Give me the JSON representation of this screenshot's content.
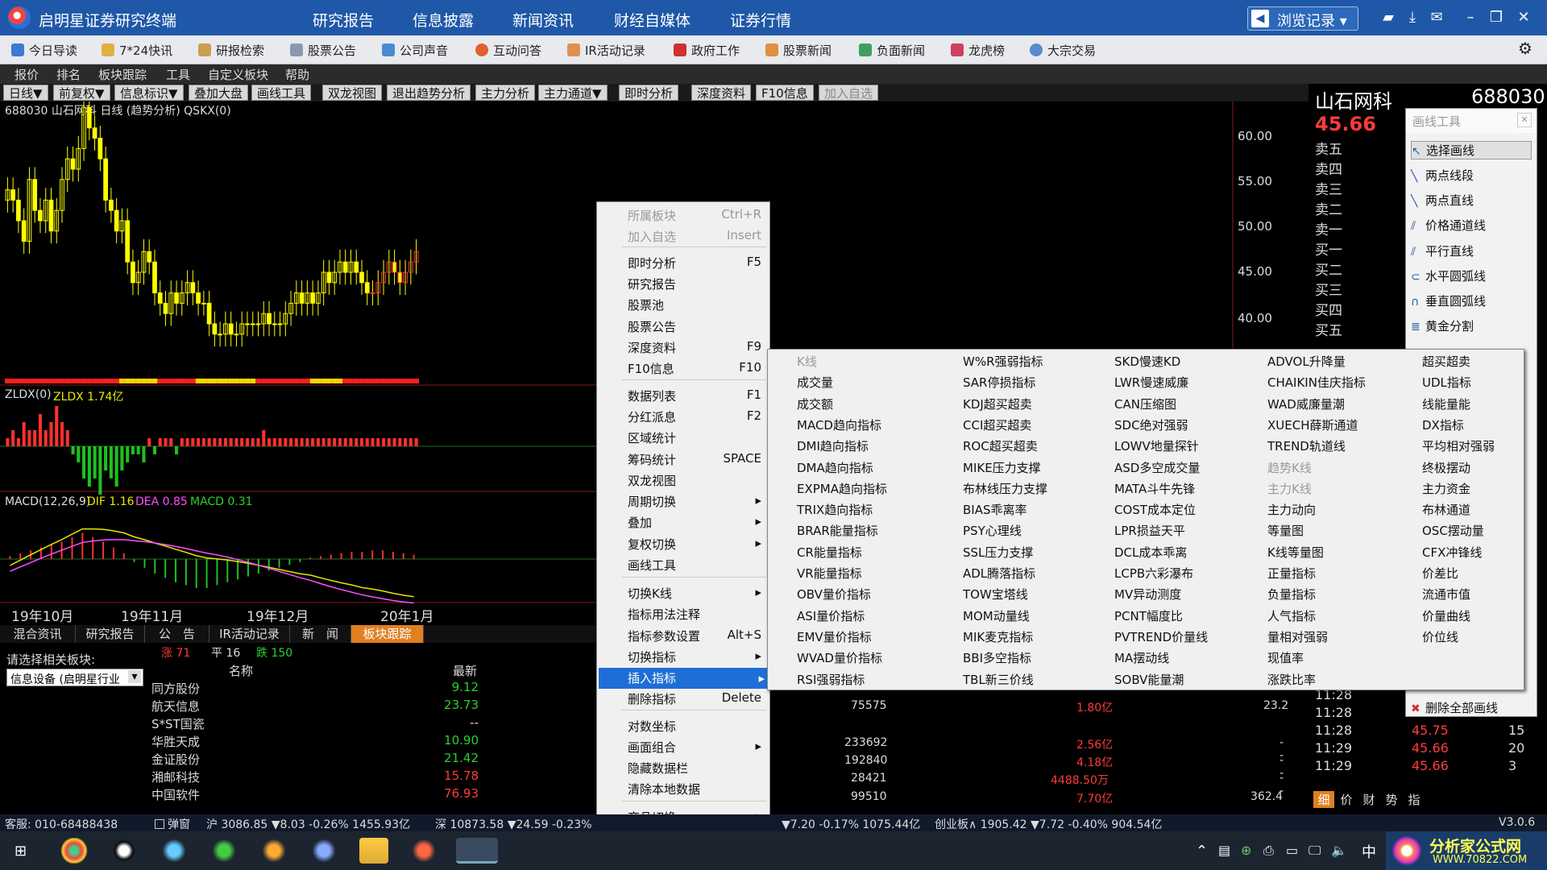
{
  "app": {
    "title": "启明星证券研究终端"
  },
  "topnav": [
    "研究报告",
    "信息披露",
    "新闻资讯",
    "财经自媒体",
    "证券行情"
  ],
  "history_btn": "浏览记录",
  "quickbar": [
    "今日导读",
    "7*24快讯",
    "研报检索",
    "股票公告",
    "公司声音",
    "互动问答",
    "IR活动记录",
    "政府工作",
    "股票新闻",
    "负面新闻",
    "龙虎榜",
    "大宗交易"
  ],
  "menubar": [
    "报价",
    "排名",
    "板块跟踪",
    "工具",
    "自定义板块",
    "帮助"
  ],
  "chartbar": [
    "日线▼",
    "前复权▼",
    "信息标识▼",
    "叠加大盘",
    "画线工具",
    "双龙视图",
    "退出趋势分析",
    "主力分析",
    "主力通道▼",
    "即时分析",
    "深度资料",
    "F10信息",
    "加入自选"
  ],
  "chart": {
    "header": "688030 山石网科 日线 (趋势分析) QSKX(0)",
    "zldx_label": "ZLDX(0)",
    "zldx_value": "ZLDX 1.74亿",
    "macd_label": "MACD(12,26,9)",
    "dif": "DIF 1.16",
    "dea": "DEA 0.85",
    "macd": "MACD 0.31",
    "yticks": [
      "60.00",
      "55.00",
      "50.00",
      "45.00",
      "40.00"
    ],
    "xticks": [
      "19年10月",
      "19年11月",
      "19年12月",
      "20年1月"
    ]
  },
  "bottom_tabs": [
    "混合资讯",
    "研究报告",
    "公　告",
    "IR活动记录",
    "新　闻",
    "板块跟踪"
  ],
  "sector": {
    "label": "请选择相关板块:",
    "selected": "信息设备 (启明星行业"
  },
  "breadth": {
    "up": "涨 71",
    "flat": "平 16",
    "down": "跌 150"
  },
  "stock_table": {
    "headers": [
      "名称",
      "最新"
    ],
    "rows": [
      {
        "name": "同方股份",
        "price": "9.12"
      },
      {
        "name": "航天信息",
        "price": "23.73"
      },
      {
        "name": "S*ST国瓷",
        "price": "--"
      },
      {
        "name": "华胜天成",
        "price": "10.90"
      },
      {
        "name": "金证股份",
        "price": "21.42"
      },
      {
        "name": "湘邮科技",
        "price": "15.78"
      },
      {
        "name": "中国软件",
        "price": "76.93"
      }
    ],
    "extra_rows": [
      {
        "vol": "75575",
        "amt": "1.80亿",
        "pe": "23.2"
      },
      {
        "vol": "233692",
        "amt": "2.56亿",
        "pe": "--"
      },
      {
        "vol": "192840",
        "amt": "4.18亿",
        "pe": "--"
      },
      {
        "vol": "28421",
        "amt": "4488.50万",
        "pe": "--"
      },
      {
        "vol": "99510",
        "amt": "7.70亿",
        "pe": "362.4"
      }
    ]
  },
  "ctxmenu": [
    {
      "label": "所属板块",
      "shortcut": "Ctrl+R",
      "disabled": true
    },
    {
      "label": "加入自选",
      "shortcut": "Insert",
      "disabled": true
    },
    {
      "label": "即时分析",
      "shortcut": "F5"
    },
    {
      "label": "研究报告",
      "shortcut": ""
    },
    {
      "label": "股票池",
      "shortcut": ""
    },
    {
      "label": "股票公告",
      "shortcut": ""
    },
    {
      "label": "深度资料",
      "shortcut": "F9"
    },
    {
      "label": "F10信息",
      "shortcut": "F10"
    },
    {
      "label": "数据列表",
      "shortcut": "F1"
    },
    {
      "label": "分红派息",
      "shortcut": "F2"
    },
    {
      "label": "区域统计",
      "shortcut": ""
    },
    {
      "label": "筹码统计",
      "shortcut": "SPACE"
    },
    {
      "label": "双龙视图",
      "shortcut": ""
    },
    {
      "label": "周期切换",
      "shortcut": "▸"
    },
    {
      "label": "叠加",
      "shortcut": "▸"
    },
    {
      "label": "复权切换",
      "shortcut": "▸"
    },
    {
      "label": "画线工具",
      "shortcut": ""
    },
    {
      "label": "切换K线",
      "shortcut": "▸"
    },
    {
      "label": "指标用法注释",
      "shortcut": ""
    },
    {
      "label": "指标参数设置",
      "shortcut": "Alt+S"
    },
    {
      "label": "切换指标",
      "shortcut": "▸"
    },
    {
      "label": "插入指标",
      "shortcut": "▸"
    },
    {
      "label": "删除指标",
      "shortcut": "Delete"
    },
    {
      "label": "对数坐标",
      "shortcut": ""
    },
    {
      "label": "画面组合",
      "shortcut": "▸"
    },
    {
      "label": "隐藏数据栏",
      "shortcut": ""
    },
    {
      "label": "清除本地数据",
      "shortcut": ""
    },
    {
      "label": "商品切换",
      "shortcut": "▸"
    }
  ],
  "submenu": [
    [
      "K线",
      "成交量",
      "成交额",
      "MACD趋向指标",
      "DMI趋向指标",
      "DMA趋向指标",
      "EXPMA趋向指标",
      "TRIX趋向指标",
      "BRAR能量指标",
      "CR能量指标",
      "VR能量指标",
      "OBV量价指标",
      "ASI量价指标",
      "EMV量价指标",
      "WVAD量价指标",
      "RSI强弱指标"
    ],
    [
      "W%R强弱指标",
      "SAR停损指标",
      "KDJ超买超卖",
      "CCI超买超卖",
      "ROC超买超卖",
      "MIKE压力支撑",
      "布林线压力支撑",
      "BIAS乖离率",
      "PSY心理线",
      "SSL压力支撑",
      "ADL腾落指标",
      "TOW宝塔线",
      "MOM动量线",
      "MIK麦克指标",
      "BBI多空指标",
      "TBL新三价线"
    ],
    [
      "SKD慢速KD",
      "LWR慢速威廉",
      "CAN压缩图",
      "SDC绝对强弱",
      "LOWV地量探针",
      "ASD多空成交量",
      "MATA斗牛先锋",
      "COST成本定位",
      "LPR损益天平",
      "DCL成本乖离",
      "LCPB六彩瀑布",
      "MV异动测度",
      "PCNT幅度比",
      "PVTREND价量线",
      "MA摆动线",
      "SOBV能量潮"
    ],
    [
      "ADVOL升降量",
      "CHAIKIN佳庆指标",
      "WAD威廉量潮",
      "XUECH薛斯通道",
      "TREND轨道线",
      "趋势K线",
      "主力K线",
      "主力动向",
      "等量图",
      "K线等量图",
      "正量指标",
      "负量指标",
      "人气指标",
      "量相对强弱",
      "现值率",
      "涨跌比率"
    ],
    [
      "超买超卖",
      "UDL指标",
      "线能量能",
      "DX指标",
      "平均相对强弱",
      "终极摆动",
      "主力资金",
      "布林通道",
      "OSC摆动量",
      "CFX冲锋线",
      "价差比",
      "流通市值",
      "价量曲线",
      "价位线"
    ]
  ],
  "quote": {
    "name": "山石网科",
    "code": "688030",
    "price": "45.66",
    "orderbook": [
      "卖五",
      "卖四",
      "卖三",
      "卖二",
      "卖一",
      "买一",
      "买二",
      "买三",
      "买四",
      "买五"
    ],
    "ticks": [
      {
        "time": "11:28",
        "price": "",
        "vol": ""
      },
      {
        "time": "11:28",
        "price": "",
        "vol": ""
      },
      {
        "time": "11:28",
        "price": "45.75",
        "vol": "15"
      },
      {
        "time": "11:29",
        "price": "45.66",
        "vol": "20"
      },
      {
        "time": "11:29",
        "price": "45.66",
        "vol": "3"
      }
    ],
    "tabs": [
      "细",
      "价",
      "财",
      "势",
      "指"
    ]
  },
  "drawtool": {
    "title": "画线工具",
    "items": [
      "选择画线",
      "两点线段",
      "两点直线",
      "价格通道线",
      "平行直线",
      "水平圆弧线",
      "垂直圆弧线",
      "黄金分割"
    ],
    "delete_all": "删除全部画线"
  },
  "statusbar": {
    "service": "客服: 010-68488438",
    "popup": "弹窗",
    "sh": "沪 3086.85 ▼8.03 -0.26% 1455.93亿",
    "sz": "深 10873.58 ▼24.59 -0.23%",
    "mid": "▼7.20 -0.17% 1075.44亿",
    "cyb": "创业板∧ 1905.42 ▼7.72 -0.40% 904.54亿",
    "version": "V3.0.6"
  },
  "taskbar": {
    "ime": "中",
    "watermark": "分析家公式网",
    "watermark_url": "WWW.70822.COM"
  },
  "colors": {
    "title_bg": "#1f58a8",
    "up": "#ff3b3b",
    "down": "#2bd12b",
    "highlight": "#1f6ed6"
  },
  "chart_data": {
    "type": "candlestick",
    "title": "688030 山石网科 日线 (趋势分析)",
    "ylim": [
      37,
      62
    ],
    "yticks": [
      60,
      55,
      50,
      45,
      40
    ],
    "closes": [
      55,
      54,
      52,
      50,
      56,
      53,
      52,
      54,
      51,
      53,
      56,
      58,
      57,
      59,
      63,
      61,
      60,
      58,
      54,
      53,
      51,
      52,
      48,
      46,
      47,
      49,
      48,
      45,
      44,
      43,
      45,
      44,
      45,
      46,
      45,
      44,
      44,
      42,
      41,
      41,
      42,
      41,
      41,
      42,
      42,
      42,
      42,
      43,
      42,
      42,
      42,
      43,
      44,
      45,
      44,
      45,
      44,
      45,
      47,
      46,
      47,
      48,
      47,
      48,
      47,
      46,
      45,
      45,
      46,
      47,
      48,
      47,
      46,
      47,
      48,
      49
    ],
    "zldx_bars": [
      1,
      2,
      1,
      3,
      2,
      2,
      4,
      2,
      3,
      5,
      3,
      2,
      -1,
      -2,
      -4,
      -5,
      -4,
      -6,
      -3,
      -4,
      -5,
      -3,
      -2,
      -1,
      -1,
      -2,
      1,
      -1,
      1,
      1,
      1,
      -1,
      1,
      1,
      1,
      1,
      1,
      1,
      1,
      1,
      1,
      1,
      1,
      1,
      1,
      1,
      1,
      2,
      1,
      1,
      1,
      1,
      1,
      1,
      1,
      1,
      1,
      1,
      1,
      1,
      1,
      1,
      1,
      1,
      1,
      1,
      1,
      1,
      1,
      1,
      1,
      1,
      1,
      1,
      1,
      1
    ],
    "macd_bars": [
      0.2,
      0.4,
      0.6,
      0.8,
      1.0,
      1.2,
      1.5,
      1.8,
      1.5,
      1.2,
      0.8,
      0.4,
      -0.2,
      -0.6,
      -1.0,
      -1.3,
      -1.6,
      -1.8,
      -2.0,
      -2.0,
      -1.8,
      -1.6,
      -1.4,
      -1.2,
      -1.0,
      -0.8,
      -0.6,
      -0.4,
      -0.2,
      0.1,
      0.2,
      0.3,
      0.4,
      0.5,
      0.5,
      0.6,
      0.6,
      0.5,
      0.4,
      0.3
    ]
  }
}
